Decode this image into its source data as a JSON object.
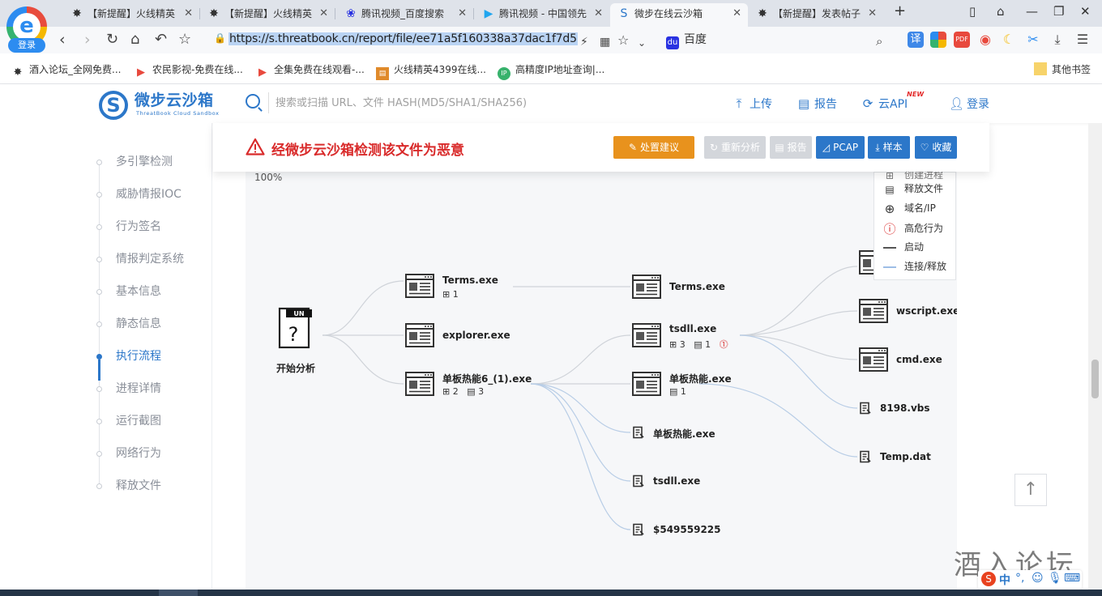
{
  "browser": {
    "login_label": "登录",
    "tabs": [
      {
        "label": "【新提醒】火线精英",
        "icon": "spider-icon"
      },
      {
        "label": "【新提醒】火线精英",
        "icon": "spider-icon"
      },
      {
        "label": "腾讯视频_百度搜索",
        "icon": "baidu-paw-icon"
      },
      {
        "label": "腾讯视频 - 中国领先",
        "icon": "tencent-video-icon"
      },
      {
        "label": "微步在线云沙箱",
        "icon": "threatbook-icon"
      },
      {
        "label": "【新提醒】发表帖子",
        "icon": "spider-icon"
      }
    ],
    "url": "https://s.threatbook.cn/report/file/ee71a5f160338a37dac1f7d5",
    "search_engine": "百度",
    "bookmarks": [
      {
        "label": "酒入论坛_全网免费..."
      },
      {
        "label": "农民影视-免费在线..."
      },
      {
        "label": "全集免费在线观看-..."
      },
      {
        "label": "火线精英4399在线..."
      },
      {
        "label": "高精度IP地址查询|..."
      },
      {
        "label": "其他书签"
      }
    ]
  },
  "site": {
    "logo_name": "微步云沙箱",
    "logo_sub": "ThreatBook Cloud Sandbox",
    "search_placeholder": "搜索或扫描 URL、文件 HASH(MD5/SHA1/SHA256)",
    "links": {
      "upload": "上传",
      "report": "报告",
      "api": "云API",
      "api_badge": "NEW",
      "login": "登录"
    }
  },
  "sidebar": {
    "items": [
      {
        "label": "多引擎检测"
      },
      {
        "label": "威胁情报IOC"
      },
      {
        "label": "行为签名"
      },
      {
        "label": "情报判定系统"
      },
      {
        "label": "基本信息"
      },
      {
        "label": "静态信息"
      },
      {
        "label": "执行流程"
      },
      {
        "label": "进程详情"
      },
      {
        "label": "运行截图"
      },
      {
        "label": "网络行为"
      },
      {
        "label": "释放文件"
      }
    ],
    "active_index": 6
  },
  "banner": {
    "title": "经微步云沙箱检测该文件为恶意",
    "buttons": {
      "advice": "处置建议",
      "reanalyze": "重新分析",
      "report": "报告",
      "pcap": "PCAP",
      "sample": "样本",
      "favorite": "收藏"
    },
    "colors": {
      "danger": "#d92b2b",
      "advice": "#e8921d",
      "primary": "#2c77c9",
      "disabled": "#d3d6db"
    }
  },
  "graph": {
    "zoom": "100%",
    "legend": {
      "partial_top": "创建进程",
      "release_file": "释放文件",
      "domain_ip": "域名/IP",
      "high_risk": "高危行为",
      "start": "启动",
      "connect_release": "连接/释放"
    },
    "root": {
      "label": "开始分析",
      "badge": "UN"
    },
    "nodes": {
      "terms1": {
        "label": "Terms.exe",
        "proc": "1"
      },
      "explorer": {
        "label": "explorer.exe"
      },
      "main": {
        "label": "单板热能6_(1).exe",
        "proc": "2",
        "file": "3"
      },
      "terms2": {
        "label": "Terms.exe"
      },
      "tsdll": {
        "label": "tsdll.exe",
        "proc": "3",
        "file": "1"
      },
      "rebanexe": {
        "label": "单板热能.exe",
        "file": "1"
      },
      "rebanfile": {
        "label": "单板热能.exe"
      },
      "tsdllfile": {
        "label": "tsdll.exe"
      },
      "dollar": {
        "label": "$549559225"
      },
      "wscript": {
        "label": "wscript.exe"
      },
      "cmd": {
        "label": "cmd.exe"
      },
      "vbs": {
        "label": "8198.vbs"
      },
      "temp": {
        "label": "Temp.dat"
      }
    }
  },
  "watermark": "酒入论坛",
  "ime": {
    "lang": "中"
  }
}
